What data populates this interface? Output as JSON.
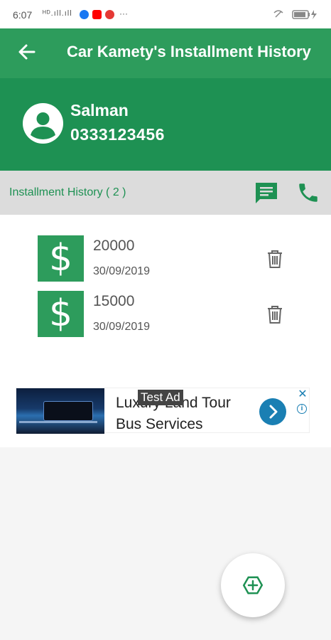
{
  "status_bar": {
    "time": "6:07",
    "signal_text": "ᴴᴰ.ıll.ıll"
  },
  "app_bar": {
    "title": "Car Kamety's Installment History"
  },
  "customer": {
    "name": "Salman",
    "phone": "0333123456"
  },
  "history": {
    "label": "Installment History ( 2 )"
  },
  "installments": [
    {
      "amount": "20000",
      "date": "30/09/2019",
      "currency_symbol": "$"
    },
    {
      "amount": "15000",
      "date": "30/09/2019",
      "currency_symbol": "$"
    }
  ],
  "ad": {
    "badge": "Test Ad",
    "line1": "Luxury Land Tour",
    "line2": "Bus Services"
  },
  "colors": {
    "primary": "#2d9c5c",
    "primary_dark": "#1e9153",
    "ad_accent": "#1a7fb3"
  }
}
